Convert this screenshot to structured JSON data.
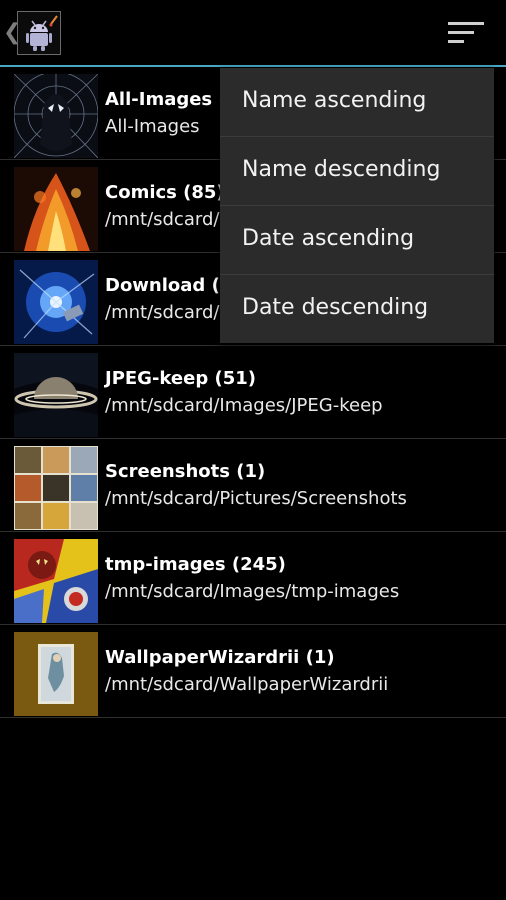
{
  "actionbar": {
    "up_glyph": "❮",
    "app_icon": "android-app-icon",
    "sort_icon": "sort-icon",
    "accent_color": "#4aa6c4"
  },
  "albums": [
    {
      "title": "All-Images (6",
      "subtitle": "All-Images",
      "thumb": "spiderman-thumb"
    },
    {
      "title": "Comics (85)",
      "subtitle": "/mnt/sdcard/",
      "thumb": "fire-comic-thumb"
    },
    {
      "title": "Download (1",
      "subtitle": "/mnt/sdcard/",
      "thumb": "blue-space-thumb"
    },
    {
      "title": "JPEG-keep (51)",
      "subtitle": "/mnt/sdcard/Images/JPEG-keep",
      "thumb": "saturn-thumb"
    },
    {
      "title": "Screenshots (1)",
      "subtitle": "/mnt/sdcard/Pictures/Screenshots",
      "thumb": "comic-grid-thumb"
    },
    {
      "title": "tmp-images (245)",
      "subtitle": "/mnt/sdcard/Images/tmp-images",
      "thumb": "captain-america-thumb"
    },
    {
      "title": "WallpaperWizardrii (1)",
      "subtitle": "/mnt/sdcard/WallpaperWizardrii",
      "thumb": "wallpaper-thumb"
    }
  ],
  "sort_menu": {
    "items": [
      "Name ascending",
      "Name descending",
      "Date ascending",
      "Date descending"
    ]
  }
}
